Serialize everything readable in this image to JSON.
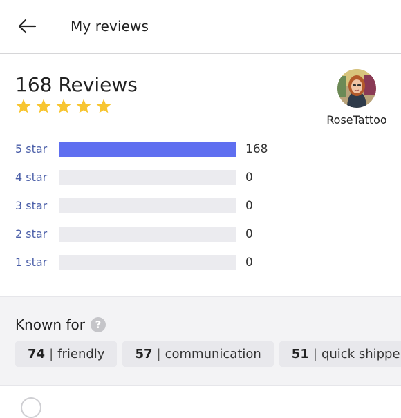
{
  "header": {
    "title": "My reviews",
    "back_icon": "arrow-left-icon"
  },
  "summary": {
    "count_text": "168 Reviews",
    "rating_stars": 5,
    "star_color": "#f7c531"
  },
  "user": {
    "name": "RoseTattoo",
    "avatar": "user-avatar"
  },
  "breakdown": {
    "bar_color": "#5f6ff0",
    "track_color": "#ebebef",
    "total": 168,
    "rows": [
      {
        "label": "5 star",
        "count": 168,
        "fraction": 1.0
      },
      {
        "label": "4 star",
        "count": 0,
        "fraction": 0
      },
      {
        "label": "3 star",
        "count": 0,
        "fraction": 0
      },
      {
        "label": "2 star",
        "count": 0,
        "fraction": 0
      },
      {
        "label": "1 star",
        "count": 0,
        "fraction": 0
      }
    ]
  },
  "known_for": {
    "title": "Known for",
    "help_icon": "question-icon",
    "chips": [
      {
        "count": "74",
        "label": "friendly"
      },
      {
        "count": "57",
        "label": "communication"
      },
      {
        "count": "51",
        "label": "quick shipper"
      }
    ]
  }
}
